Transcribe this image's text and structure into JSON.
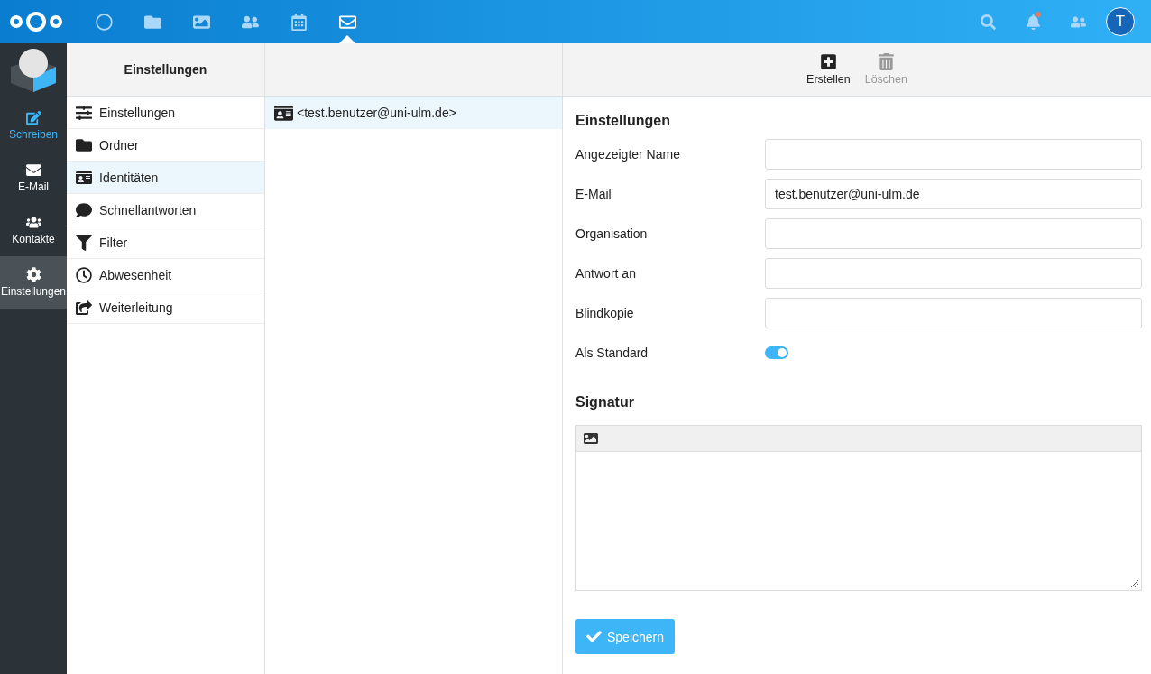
{
  "top_apps": [
    {
      "kind": "dashboard",
      "selected": false
    },
    {
      "kind": "files",
      "selected": false
    },
    {
      "kind": "photos",
      "selected": false
    },
    {
      "kind": "contacts",
      "selected": false
    },
    {
      "kind": "calendar",
      "selected": false
    },
    {
      "kind": "mail",
      "selected": true
    }
  ],
  "header_actions": [
    {
      "kind": "search"
    },
    {
      "kind": "notifications",
      "unread": true
    },
    {
      "kind": "contacts"
    }
  ],
  "avatar": {
    "initial": "T"
  },
  "app_nav": [
    {
      "kind": "compose",
      "label": "Schreiben",
      "highlighted": true,
      "selected": false
    },
    {
      "kind": "mail",
      "label": "E-Mail",
      "highlighted": false,
      "selected": false
    },
    {
      "kind": "contacts",
      "label": "Kontakte",
      "highlighted": false,
      "selected": false
    },
    {
      "kind": "settings",
      "label": "Einstellungen",
      "highlighted": false,
      "selected": true
    }
  ],
  "settings_menu": {
    "title": "Einstellungen",
    "items": [
      {
        "kind": "sliders",
        "label": "Einstellungen",
        "selected": false
      },
      {
        "kind": "folder",
        "label": "Ordner",
        "selected": false
      },
      {
        "kind": "identity",
        "label": "Identitäten",
        "selected": true
      },
      {
        "kind": "comment",
        "label": "Schnellantworten",
        "selected": false
      },
      {
        "kind": "filter",
        "label": "Filter",
        "selected": false
      },
      {
        "kind": "clock",
        "label": "Abwesenheit",
        "selected": false
      },
      {
        "kind": "forward",
        "label": "Weiterleitung",
        "selected": false
      }
    ]
  },
  "identities": [
    {
      "label": "<test.benutzer@uni-ulm.de>",
      "selected": true
    }
  ],
  "toolbar": [
    {
      "kind": "create",
      "label": "Erstellen",
      "disabled": false
    },
    {
      "kind": "delete",
      "label": "Löschen",
      "disabled": true
    }
  ],
  "form": {
    "title": "Einstellungen",
    "fields": [
      {
        "kind": "text",
        "label": "Angezeigter Name"
      },
      {
        "kind": "text",
        "label": "E-Mail",
        "value": "test.benutzer@uni-ulm.de"
      },
      {
        "kind": "text",
        "label": "Organisation"
      },
      {
        "kind": "text",
        "label": "Antwort an"
      },
      {
        "kind": "text",
        "label": "Blindkopie"
      },
      {
        "kind": "toggle",
        "label": "Als Standard",
        "on": true
      }
    ],
    "signature_title": "Signatur",
    "save_label": "Speichern"
  }
}
